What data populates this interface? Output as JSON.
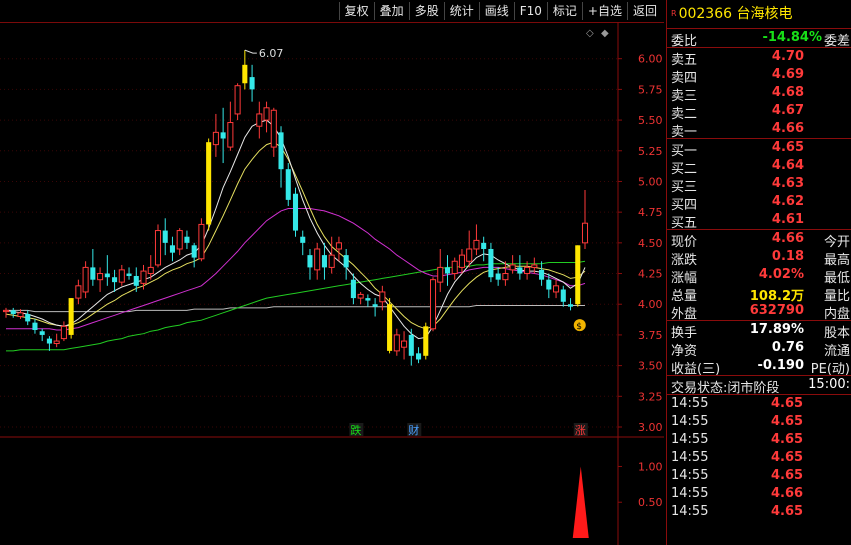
{
  "toolbar": {
    "buttons": [
      "复权",
      "叠加",
      "多股",
      "统计",
      "画线",
      "F10",
      "标记",
      "+自选",
      "返回"
    ]
  },
  "stock": {
    "code": "002366",
    "name": "台海核电",
    "tag": "R"
  },
  "weibi": {
    "label": "委比",
    "value": "-14.84%",
    "label2": "委差"
  },
  "asks": [
    {
      "label": "卖五",
      "price": "4.70"
    },
    {
      "label": "卖四",
      "price": "4.69"
    },
    {
      "label": "卖三",
      "price": "4.68"
    },
    {
      "label": "卖二",
      "price": "4.67"
    },
    {
      "label": "卖一",
      "price": "4.66"
    }
  ],
  "bids": [
    {
      "label": "买一",
      "price": "4.65"
    },
    {
      "label": "买二",
      "price": "4.64"
    },
    {
      "label": "买三",
      "price": "4.63"
    },
    {
      "label": "买四",
      "price": "4.62"
    },
    {
      "label": "买五",
      "price": "4.61"
    }
  ],
  "quote1": [
    {
      "label": "现价",
      "value": "4.66",
      "right": "今开",
      "color": "red"
    },
    {
      "label": "涨跌",
      "value": "0.18",
      "right": "最高",
      "color": "red"
    },
    {
      "label": "涨幅",
      "value": "4.02%",
      "right": "最低",
      "color": "red"
    },
    {
      "label": "总量",
      "value": "108.2万",
      "right": "量比",
      "color": "yellow"
    },
    {
      "label": "外盘",
      "value": "632790",
      "right": "内盘",
      "color": "red"
    }
  ],
  "quote2": [
    {
      "label": "换手",
      "value": "17.89%",
      "right": "股本",
      "color": "white"
    },
    {
      "label": "净资",
      "value": "0.76",
      "right": "流通",
      "color": "white"
    },
    {
      "label": "收益(三)",
      "value": "-0.190",
      "right": "PE(动)",
      "color": "white"
    }
  ],
  "trade_status": {
    "label": "交易状态:",
    "value": "闭市阶段",
    "time": "15:00:"
  },
  "ticks": [
    {
      "time": "14:55",
      "price": "4.65"
    },
    {
      "time": "14:55",
      "price": "4.65"
    },
    {
      "time": "14:55",
      "price": "4.65"
    },
    {
      "time": "14:55",
      "price": "4.65"
    },
    {
      "time": "14:55",
      "price": "4.65"
    },
    {
      "time": "14:55",
      "price": "4.66"
    },
    {
      "time": "14:55",
      "price": "4.65"
    }
  ],
  "chart": {
    "y_ticks": [
      "6.00",
      "5.75",
      "5.50",
      "5.25",
      "5.00",
      "4.75",
      "4.50",
      "4.25",
      "4.00",
      "3.75",
      "3.50",
      "3.25",
      "3.00"
    ],
    "vol_ticks": [
      "1.00",
      "0.50"
    ],
    "high_label": "6.07",
    "markers": [
      {
        "text": "跌",
        "color": "#18e018"
      },
      {
        "text": "财",
        "color": "#4aa0ff"
      },
      {
        "text": "涨",
        "color": "#ff3a3a"
      }
    ]
  },
  "chart_data": {
    "type": "candlestick",
    "ylim": [
      3.0,
      6.25
    ],
    "candles": [
      [
        3.94,
        3.95,
        3.89,
        3.97
      ],
      [
        3.95,
        3.92,
        3.89,
        3.97
      ],
      [
        3.9,
        3.93,
        3.88,
        3.96
      ],
      [
        3.92,
        3.86,
        3.83,
        3.95
      ],
      [
        3.85,
        3.79,
        3.76,
        3.88
      ],
      [
        3.78,
        3.75,
        3.7,
        3.8
      ],
      [
        3.72,
        3.68,
        3.62,
        3.74
      ],
      [
        3.68,
        3.7,
        3.65,
        3.76
      ],
      [
        3.72,
        3.82,
        3.7,
        3.86
      ],
      [
        3.75,
        4.05,
        3.72,
        4.05
      ],
      [
        4.05,
        4.15,
        4.0,
        4.2
      ],
      [
        4.1,
        4.3,
        4.05,
        4.35
      ],
      [
        4.3,
        4.2,
        4.15,
        4.45
      ],
      [
        4.2,
        4.25,
        4.1,
        4.3
      ],
      [
        4.25,
        4.22,
        4.15,
        4.4
      ],
      [
        4.22,
        4.18,
        4.1,
        4.28
      ],
      [
        4.18,
        4.28,
        4.15,
        4.32
      ],
      [
        4.25,
        4.23,
        4.2,
        4.3
      ],
      [
        4.23,
        4.15,
        4.1,
        4.3
      ],
      [
        4.17,
        4.27,
        4.12,
        4.32
      ],
      [
        4.25,
        4.3,
        4.2,
        4.4
      ],
      [
        4.32,
        4.6,
        4.3,
        4.65
      ],
      [
        4.6,
        4.5,
        4.4,
        4.7
      ],
      [
        4.48,
        4.42,
        4.35,
        4.55
      ],
      [
        4.45,
        4.6,
        4.4,
        4.62
      ],
      [
        4.55,
        4.5,
        4.45,
        4.6
      ],
      [
        4.48,
        4.38,
        4.3,
        4.5
      ],
      [
        4.37,
        4.65,
        4.35,
        4.7
      ],
      [
        4.65,
        5.32,
        4.6,
        5.35
      ],
      [
        5.3,
        5.4,
        5.2,
        5.55
      ],
      [
        5.4,
        5.35,
        5.15,
        5.6
      ],
      [
        5.28,
        5.48,
        5.25,
        5.65
      ],
      [
        5.55,
        5.78,
        5.5,
        5.8
      ],
      [
        5.8,
        5.95,
        5.75,
        6.07
      ],
      [
        5.85,
        5.75,
        5.65,
        5.95
      ],
      [
        5.45,
        5.55,
        5.35,
        5.65
      ],
      [
        5.5,
        5.6,
        5.4,
        5.65
      ],
      [
        5.28,
        5.58,
        5.2,
        5.6
      ],
      [
        5.4,
        5.1,
        4.95,
        5.45
      ],
      [
        5.1,
        4.85,
        4.8,
        5.15
      ],
      [
        4.9,
        4.6,
        4.55,
        4.95
      ],
      [
        4.55,
        4.5,
        4.4,
        4.6
      ],
      [
        4.4,
        4.3,
        4.2,
        4.45
      ],
      [
        4.28,
        4.45,
        4.2,
        4.5
      ],
      [
        4.4,
        4.3,
        4.2,
        4.5
      ],
      [
        4.3,
        4.4,
        4.25,
        4.55
      ],
      [
        4.45,
        4.5,
        4.35,
        4.55
      ],
      [
        4.4,
        4.3,
        4.2,
        4.45
      ],
      [
        4.2,
        4.05,
        4.0,
        4.25
      ],
      [
        4.05,
        4.08,
        4.0,
        4.1
      ],
      [
        4.05,
        4.03,
        3.98,
        4.08
      ],
      [
        4.0,
        3.98,
        3.9,
        4.05
      ],
      [
        4.02,
        4.1,
        3.95,
        4.15
      ],
      [
        4.0,
        3.62,
        3.6,
        4.05
      ],
      [
        3.62,
        3.75,
        3.58,
        3.8
      ],
      [
        3.65,
        3.7,
        3.55,
        3.78
      ],
      [
        3.75,
        3.58,
        3.5,
        3.8
      ],
      [
        3.6,
        3.55,
        3.52,
        3.65
      ],
      [
        3.58,
        3.82,
        3.55,
        3.85
      ],
      [
        3.8,
        4.2,
        3.78,
        4.22
      ],
      [
        4.18,
        4.3,
        4.1,
        4.45
      ],
      [
        4.3,
        4.25,
        4.15,
        4.4
      ],
      [
        4.25,
        4.35,
        4.2,
        4.38
      ],
      [
        4.3,
        4.4,
        4.25,
        4.45
      ],
      [
        4.35,
        4.45,
        4.3,
        4.6
      ],
      [
        4.45,
        4.52,
        4.4,
        4.65
      ],
      [
        4.5,
        4.45,
        4.35,
        4.55
      ],
      [
        4.45,
        4.22,
        4.18,
        4.5
      ],
      [
        4.25,
        4.2,
        4.15,
        4.3
      ],
      [
        4.2,
        4.25,
        4.15,
        4.35
      ],
      [
        4.28,
        4.32,
        4.25,
        4.4
      ],
      [
        4.3,
        4.25,
        4.2,
        4.4
      ],
      [
        4.25,
        4.3,
        4.2,
        4.35
      ],
      [
        4.3,
        4.32,
        4.25,
        4.38
      ],
      [
        4.28,
        4.2,
        4.15,
        4.35
      ],
      [
        4.2,
        4.12,
        4.05,
        4.25
      ],
      [
        4.1,
        4.15,
        4.05,
        4.2
      ],
      [
        4.12,
        4.02,
        3.98,
        4.15
      ],
      [
        4.0,
        3.98,
        3.95,
        4.05
      ],
      [
        4.0,
        4.48,
        3.98,
        4.48
      ],
      [
        4.5,
        4.66,
        4.45,
        4.93
      ]
    ],
    "ma_white": [
      3.95,
      3.94,
      3.93,
      3.92,
      3.9,
      3.88,
      3.85,
      3.83,
      3.82,
      3.84,
      3.88,
      3.93,
      3.98,
      4.03,
      4.08,
      4.11,
      4.14,
      4.16,
      4.18,
      4.2,
      4.22,
      4.26,
      4.3,
      4.33,
      4.36,
      4.4,
      4.42,
      4.48,
      4.62,
      4.78,
      4.95,
      5.08,
      5.22,
      5.36,
      5.45,
      5.48,
      5.5,
      5.45,
      5.35,
      5.2,
      5.02,
      4.85,
      4.7,
      4.58,
      4.48,
      4.4,
      4.35,
      4.3,
      4.23,
      4.17,
      4.12,
      4.08,
      4.06,
      3.98,
      3.9,
      3.82,
      3.76,
      3.72,
      3.73,
      3.82,
      3.95,
      4.08,
      4.18,
      4.25,
      4.32,
      4.38,
      4.41,
      4.4,
      4.36,
      4.33,
      4.3,
      4.28,
      4.27,
      4.27,
      4.26,
      4.24,
      4.21,
      4.18,
      4.13,
      4.17,
      4.3
    ],
    "ma_yellow": [
      3.92,
      3.91,
      3.9,
      3.89,
      3.88,
      3.86,
      3.84,
      3.83,
      3.82,
      3.83,
      3.85,
      3.88,
      3.92,
      3.96,
      4.0,
      4.03,
      4.07,
      4.1,
      4.13,
      4.15,
      4.18,
      4.21,
      4.25,
      4.28,
      4.3,
      4.33,
      4.35,
      4.38,
      4.48,
      4.6,
      4.72,
      4.85,
      4.98,
      5.1,
      5.18,
      5.25,
      5.3,
      5.32,
      5.28,
      5.18,
      5.05,
      4.92,
      4.78,
      4.65,
      4.55,
      4.47,
      4.42,
      4.37,
      4.32,
      4.26,
      4.2,
      4.13,
      4.08,
      4.02,
      3.96,
      3.9,
      3.85,
      3.82,
      3.8,
      3.82,
      3.88,
      3.96,
      4.04,
      4.11,
      4.17,
      4.22,
      4.26,
      4.28,
      4.29,
      4.3,
      4.31,
      4.31,
      4.31,
      4.3,
      4.29,
      4.28,
      4.26,
      4.24,
      4.21,
      4.22,
      4.27
    ],
    "ma_magenta": [
      3.8,
      3.8,
      3.8,
      3.8,
      3.8,
      3.8,
      3.8,
      3.79,
      3.79,
      3.8,
      3.81,
      3.83,
      3.85,
      3.87,
      3.89,
      3.91,
      3.93,
      3.95,
      3.97,
      3.99,
      4.01,
      4.03,
      4.05,
      4.07,
      4.09,
      4.11,
      4.13,
      4.15,
      4.2,
      4.25,
      4.31,
      4.37,
      4.43,
      4.5,
      4.56,
      4.62,
      4.68,
      4.72,
      4.76,
      4.78,
      4.78,
      4.78,
      4.78,
      4.77,
      4.76,
      4.74,
      4.72,
      4.69,
      4.66,
      4.62,
      4.58,
      4.53,
      4.49,
      4.45,
      4.4,
      4.36,
      4.32,
      4.28,
      4.25,
      4.23,
      4.23,
      4.24,
      4.25,
      4.26,
      4.28,
      4.29,
      4.3,
      4.3,
      4.3,
      4.29,
      4.28,
      4.27,
      4.26,
      4.25,
      4.24,
      4.22,
      4.2,
      4.18,
      4.15,
      4.15,
      4.17
    ],
    "ma_green": [
      3.62,
      3.62,
      3.63,
      3.63,
      3.63,
      3.63,
      3.63,
      3.63,
      3.63,
      3.64,
      3.65,
      3.66,
      3.67,
      3.68,
      3.7,
      3.71,
      3.72,
      3.74,
      3.75,
      3.76,
      3.78,
      3.79,
      3.81,
      3.82,
      3.83,
      3.85,
      3.86,
      3.87,
      3.89,
      3.91,
      3.93,
      3.95,
      3.97,
      3.99,
      4.01,
      4.03,
      4.05,
      4.06,
      4.07,
      4.08,
      4.09,
      4.1,
      4.11,
      4.12,
      4.13,
      4.14,
      4.15,
      4.16,
      4.17,
      4.18,
      4.19,
      4.2,
      4.21,
      4.22,
      4.23,
      4.24,
      4.25,
      4.26,
      4.27,
      4.28,
      4.29,
      4.3,
      4.3,
      4.31,
      4.31,
      4.32,
      4.32,
      4.33,
      4.33,
      4.33,
      4.33,
      4.33,
      4.33,
      4.33,
      4.33,
      4.34,
      4.34,
      4.34,
      4.34,
      4.34,
      4.35
    ],
    "ma_gray": [
      3.95,
      3.95,
      3.95,
      3.95,
      3.94,
      3.94,
      3.94,
      3.94,
      3.94,
      3.94,
      3.94,
      3.94,
      3.94,
      3.94,
      3.94,
      3.94,
      3.94,
      3.94,
      3.95,
      3.95,
      3.95,
      3.95,
      3.95,
      3.95,
      3.95,
      3.95,
      3.96,
      3.96,
      3.96,
      3.96,
      3.96,
      3.97,
      3.97,
      3.97,
      3.97,
      3.97,
      3.97,
      3.98,
      3.98,
      3.98,
      3.98,
      3.98,
      3.98,
      3.98,
      3.98,
      3.98,
      3.98,
      3.98,
      3.98,
      3.98,
      3.98,
      3.98,
      3.98,
      3.98,
      3.98,
      3.98,
      3.98,
      3.98,
      3.98,
      3.98,
      3.98,
      3.98,
      3.98,
      3.98,
      3.98,
      3.99,
      3.99,
      3.99,
      3.99,
      3.99,
      3.99,
      3.99,
      3.99,
      3.99,
      3.99,
      3.99,
      3.99,
      3.99,
      3.99,
      3.99,
      3.99
    ],
    "yellow_bars": [
      9,
      28,
      33,
      53,
      58,
      79
    ],
    "volume_spike": 1.0
  }
}
